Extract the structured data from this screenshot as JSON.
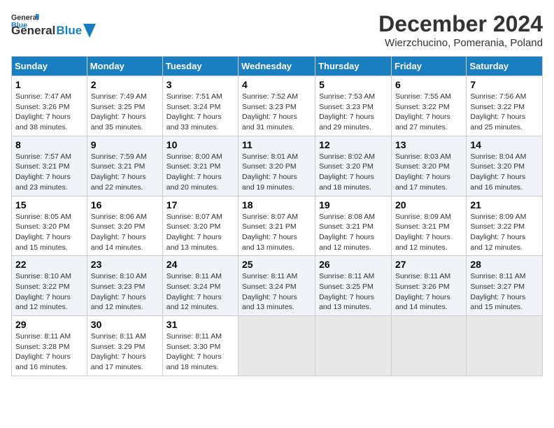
{
  "header": {
    "logo_line1": "General",
    "logo_line2": "Blue",
    "month": "December 2024",
    "location": "Wierzchucino, Pomerania, Poland"
  },
  "days_of_week": [
    "Sunday",
    "Monday",
    "Tuesday",
    "Wednesday",
    "Thursday",
    "Friday",
    "Saturday"
  ],
  "weeks": [
    [
      {
        "day": "1",
        "info": "Sunrise: 7:47 AM\nSunset: 3:26 PM\nDaylight: 7 hours and 38 minutes."
      },
      {
        "day": "2",
        "info": "Sunrise: 7:49 AM\nSunset: 3:25 PM\nDaylight: 7 hours and 35 minutes."
      },
      {
        "day": "3",
        "info": "Sunrise: 7:51 AM\nSunset: 3:24 PM\nDaylight: 7 hours and 33 minutes."
      },
      {
        "day": "4",
        "info": "Sunrise: 7:52 AM\nSunset: 3:23 PM\nDaylight: 7 hours and 31 minutes."
      },
      {
        "day": "5",
        "info": "Sunrise: 7:53 AM\nSunset: 3:23 PM\nDaylight: 7 hours and 29 minutes."
      },
      {
        "day": "6",
        "info": "Sunrise: 7:55 AM\nSunset: 3:22 PM\nDaylight: 7 hours and 27 minutes."
      },
      {
        "day": "7",
        "info": "Sunrise: 7:56 AM\nSunset: 3:22 PM\nDaylight: 7 hours and 25 minutes."
      }
    ],
    [
      {
        "day": "8",
        "info": "Sunrise: 7:57 AM\nSunset: 3:21 PM\nDaylight: 7 hours and 23 minutes."
      },
      {
        "day": "9",
        "info": "Sunrise: 7:59 AM\nSunset: 3:21 PM\nDaylight: 7 hours and 22 minutes."
      },
      {
        "day": "10",
        "info": "Sunrise: 8:00 AM\nSunset: 3:21 PM\nDaylight: 7 hours and 20 minutes."
      },
      {
        "day": "11",
        "info": "Sunrise: 8:01 AM\nSunset: 3:20 PM\nDaylight: 7 hours and 19 minutes."
      },
      {
        "day": "12",
        "info": "Sunrise: 8:02 AM\nSunset: 3:20 PM\nDaylight: 7 hours and 18 minutes."
      },
      {
        "day": "13",
        "info": "Sunrise: 8:03 AM\nSunset: 3:20 PM\nDaylight: 7 hours and 17 minutes."
      },
      {
        "day": "14",
        "info": "Sunrise: 8:04 AM\nSunset: 3:20 PM\nDaylight: 7 hours and 16 minutes."
      }
    ],
    [
      {
        "day": "15",
        "info": "Sunrise: 8:05 AM\nSunset: 3:20 PM\nDaylight: 7 hours and 15 minutes."
      },
      {
        "day": "16",
        "info": "Sunrise: 8:06 AM\nSunset: 3:20 PM\nDaylight: 7 hours and 14 minutes."
      },
      {
        "day": "17",
        "info": "Sunrise: 8:07 AM\nSunset: 3:20 PM\nDaylight: 7 hours and 13 minutes."
      },
      {
        "day": "18",
        "info": "Sunrise: 8:07 AM\nSunset: 3:21 PM\nDaylight: 7 hours and 13 minutes."
      },
      {
        "day": "19",
        "info": "Sunrise: 8:08 AM\nSunset: 3:21 PM\nDaylight: 7 hours and 12 minutes."
      },
      {
        "day": "20",
        "info": "Sunrise: 8:09 AM\nSunset: 3:21 PM\nDaylight: 7 hours and 12 minutes."
      },
      {
        "day": "21",
        "info": "Sunrise: 8:09 AM\nSunset: 3:22 PM\nDaylight: 7 hours and 12 minutes."
      }
    ],
    [
      {
        "day": "22",
        "info": "Sunrise: 8:10 AM\nSunset: 3:22 PM\nDaylight: 7 hours and 12 minutes."
      },
      {
        "day": "23",
        "info": "Sunrise: 8:10 AM\nSunset: 3:23 PM\nDaylight: 7 hours and 12 minutes."
      },
      {
        "day": "24",
        "info": "Sunrise: 8:11 AM\nSunset: 3:24 PM\nDaylight: 7 hours and 12 minutes."
      },
      {
        "day": "25",
        "info": "Sunrise: 8:11 AM\nSunset: 3:24 PM\nDaylight: 7 hours and 13 minutes."
      },
      {
        "day": "26",
        "info": "Sunrise: 8:11 AM\nSunset: 3:25 PM\nDaylight: 7 hours and 13 minutes."
      },
      {
        "day": "27",
        "info": "Sunrise: 8:11 AM\nSunset: 3:26 PM\nDaylight: 7 hours and 14 minutes."
      },
      {
        "day": "28",
        "info": "Sunrise: 8:11 AM\nSunset: 3:27 PM\nDaylight: 7 hours and 15 minutes."
      }
    ],
    [
      {
        "day": "29",
        "info": "Sunrise: 8:11 AM\nSunset: 3:28 PM\nDaylight: 7 hours and 16 minutes."
      },
      {
        "day": "30",
        "info": "Sunrise: 8:11 AM\nSunset: 3:29 PM\nDaylight: 7 hours and 17 minutes."
      },
      {
        "day": "31",
        "info": "Sunrise: 8:11 AM\nSunset: 3:30 PM\nDaylight: 7 hours and 18 minutes."
      },
      null,
      null,
      null,
      null
    ]
  ]
}
